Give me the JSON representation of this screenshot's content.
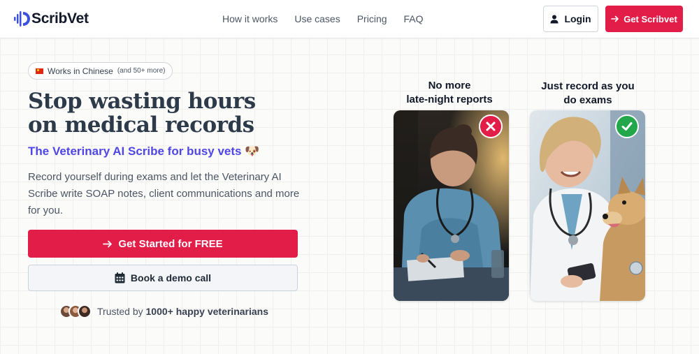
{
  "brand": {
    "name": "ScribVet",
    "accent": "#e11d48",
    "secondary": "#4f46e5"
  },
  "nav": {
    "items": [
      {
        "label": "How it works"
      },
      {
        "label": "Use cases"
      },
      {
        "label": "Pricing"
      },
      {
        "label": "FAQ"
      }
    ],
    "login_label": "Login",
    "cta_label": "Get Scribvet"
  },
  "hero": {
    "badge": {
      "text": "Works in Chinese",
      "sub": "(and 50+ more)",
      "icon": "china-flag-icon"
    },
    "title_line1": "Stop wasting hours",
    "title_line2": "on medical records",
    "tagline": "The Veterinary AI Scribe for busy vets 🐶",
    "description": "Record yourself during exams and let the Veterinary AI Scribe write SOAP notes, client communications and more for you.",
    "primary_button": "Get Started for FREE",
    "secondary_button": "Book a demo call",
    "trust_prefix": "Trusted by",
    "trust_strong": "1000+ happy veterinarians"
  },
  "comparison": {
    "before": {
      "caption_line1": "No more",
      "caption_line2": "late-night reports",
      "icon": "x-mark-icon"
    },
    "after": {
      "caption_line1": "Just record as you",
      "caption_line2": "do exams",
      "icon": "check-icon"
    }
  }
}
